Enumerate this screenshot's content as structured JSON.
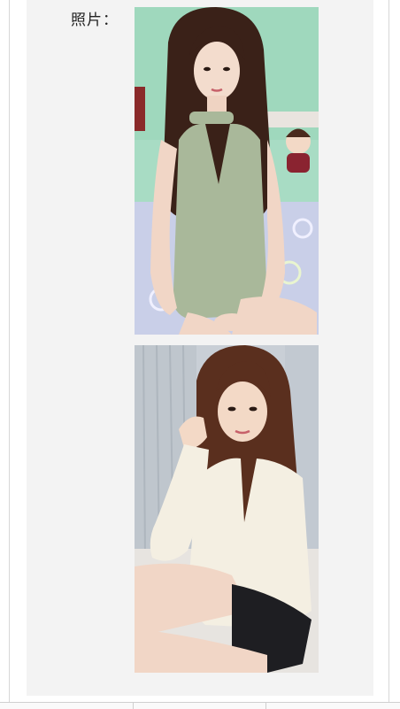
{
  "form": {
    "photo_label": "照片："
  },
  "photos": [
    {
      "icon": "photo-woman-green-dress",
      "accent": "#a9b89a",
      "background": "#a8dcc4"
    },
    {
      "icon": "photo-woman-white-sweater",
      "accent": "#f4efe2",
      "background": "#c9cfd6"
    }
  ]
}
